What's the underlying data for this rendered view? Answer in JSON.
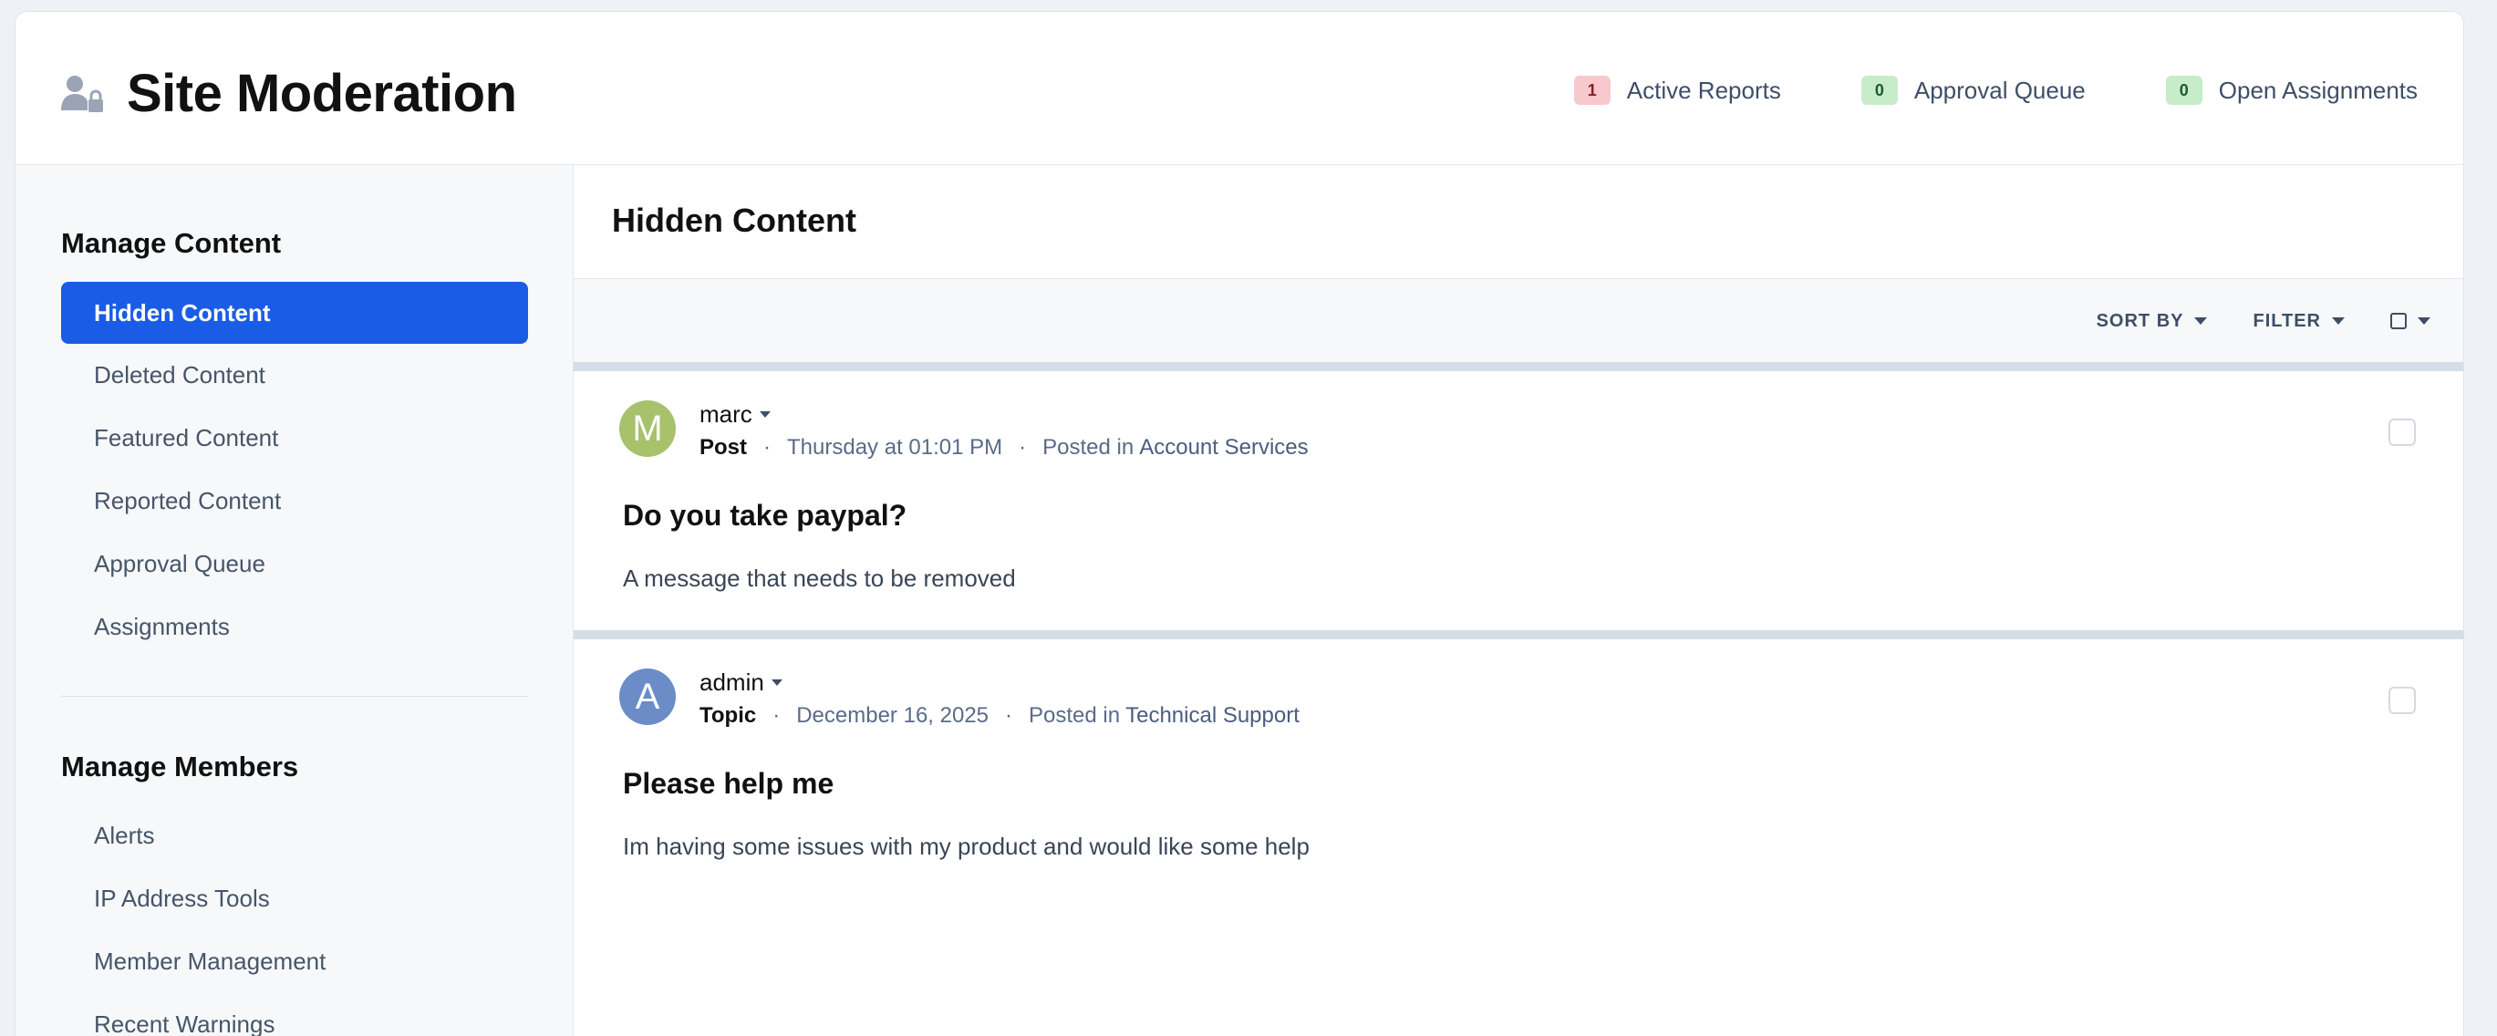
{
  "header": {
    "title": "Site Moderation",
    "icon": "moderator-icon",
    "stats": [
      {
        "count": "1",
        "label": "Active Reports",
        "color": "red"
      },
      {
        "count": "0",
        "label": "Approval Queue",
        "color": "green"
      },
      {
        "count": "0",
        "label": "Open Assignments",
        "color": "green"
      }
    ]
  },
  "sidebar": {
    "content_section": {
      "title": "Manage Content",
      "items": [
        {
          "label": "Hidden Content",
          "active": true
        },
        {
          "label": "Deleted Content"
        },
        {
          "label": "Featured Content"
        },
        {
          "label": "Reported Content"
        },
        {
          "label": "Approval Queue"
        },
        {
          "label": "Assignments"
        }
      ]
    },
    "members_section": {
      "title": "Manage Members",
      "items": [
        {
          "label": "Alerts"
        },
        {
          "label": "IP Address Tools"
        },
        {
          "label": "Member Management"
        },
        {
          "label": "Recent Warnings"
        }
      ]
    }
  },
  "main": {
    "title": "Hidden Content",
    "toolbar": {
      "sort_label": "SORT BY",
      "filter_label": "FILTER"
    },
    "posts": [
      {
        "avatar_letter": "M",
        "avatar_color": "#a7c26a",
        "author": "marc",
        "type": "Post",
        "date": "Thursday at 01:01 PM",
        "posted_in_prefix": "Posted in",
        "forum": "Account Services",
        "title": "Do you take paypal?",
        "body": "A message that needs to be removed"
      },
      {
        "avatar_letter": "A",
        "avatar_color": "#6b8cc7",
        "author": "admin",
        "type": "Topic",
        "date": "December 16, 2025",
        "posted_in_prefix": "Posted in",
        "forum": "Technical Support",
        "title": "Please help me",
        "body": "Im having some issues with my product and would like some help"
      }
    ],
    "separator": "·"
  },
  "colors": {
    "accent": "#1a5ce6",
    "page_bg": "#eef1f5"
  }
}
